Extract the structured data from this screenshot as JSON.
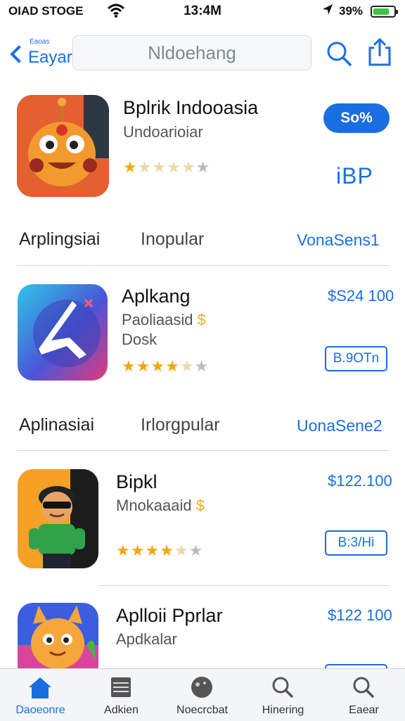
{
  "status_bar": {
    "carrier": "OIAD STOGE",
    "time": "13:4M",
    "battery": "39%",
    "battery_level": 0.7,
    "icons": [
      "wifi-icon",
      "location-icon",
      "battery-icon"
    ]
  },
  "nav": {
    "back_small": "Eaoas",
    "back_label": "Eayar",
    "search_text": "Nldoehang",
    "icons": [
      "chevron-left-icon",
      "search-icon",
      "share-icon"
    ]
  },
  "featured": {
    "name": "Bplrik Indooasia",
    "subtitle": "Undoarioiar",
    "rating_stars": 1.5,
    "button": "So%",
    "badge": "iBP"
  },
  "sections": [
    {
      "title": "Arplingsiai",
      "middle": "Inopular",
      "link": "VonaSens1"
    },
    {
      "title": "Aplinasiai",
      "middle": "Irlorgpular",
      "link": "UonaSene2"
    }
  ],
  "apps": [
    {
      "name": "Aplkang",
      "subtitle": "Paoliaasid",
      "subtitle2": "Dosk",
      "dollar": "$",
      "price": "$S24 100",
      "button": "B.9OTn",
      "rating_stars": 3.5
    },
    {
      "name": "Bipkl",
      "subtitle": "Mnokaaaid",
      "dollar": "$",
      "price": "$122.100",
      "button": "B:3/Hi",
      "rating_stars": 3.5
    },
    {
      "name": "Aplloii Pprlar",
      "subtitle": "Apdkalar",
      "price": "$122 100"
    }
  ],
  "tabbar": {
    "tabs": [
      {
        "label": "Daoeonre",
        "icon": "home-icon",
        "active": true
      },
      {
        "label": "Adkien",
        "icon": "list-icon",
        "active": false
      },
      {
        "label": "Noecrcbat",
        "icon": "games-icon",
        "active": false
      },
      {
        "label": "Hinering",
        "icon": "search-icon",
        "active": false
      },
      {
        "label": "Eaear",
        "icon": "search-icon",
        "active": false
      }
    ]
  },
  "colors": {
    "accent": "#1a6fe0",
    "star": "#f0a816",
    "battery": "#3fc43f"
  }
}
